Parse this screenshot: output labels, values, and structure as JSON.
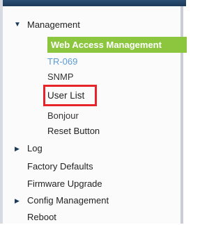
{
  "nav": {
    "management": {
      "label": "Management",
      "expanded": true
    },
    "sub_items": {
      "web_access": "Web Access Management",
      "tr069": "TR-069",
      "snmp": "SNMP",
      "user_list": "User List",
      "bonjour": "Bonjour",
      "reset_button": "Reset Button"
    },
    "log": {
      "label": "Log",
      "expanded": false
    },
    "factory_defaults": "Factory Defaults",
    "firmware_upgrade": "Firmware Upgrade",
    "config_management": {
      "label": "Config Management",
      "expanded": false
    },
    "reboot": "Reboot"
  },
  "colors": {
    "active_item_bg": "#8cc63f",
    "highlight_border": "#e8242b",
    "link_blue": "#5b9bd5",
    "top_bar": "#1d3a5a"
  },
  "icons": {
    "expanded": "triangle-down-icon",
    "collapsed": "triangle-right-icon"
  }
}
